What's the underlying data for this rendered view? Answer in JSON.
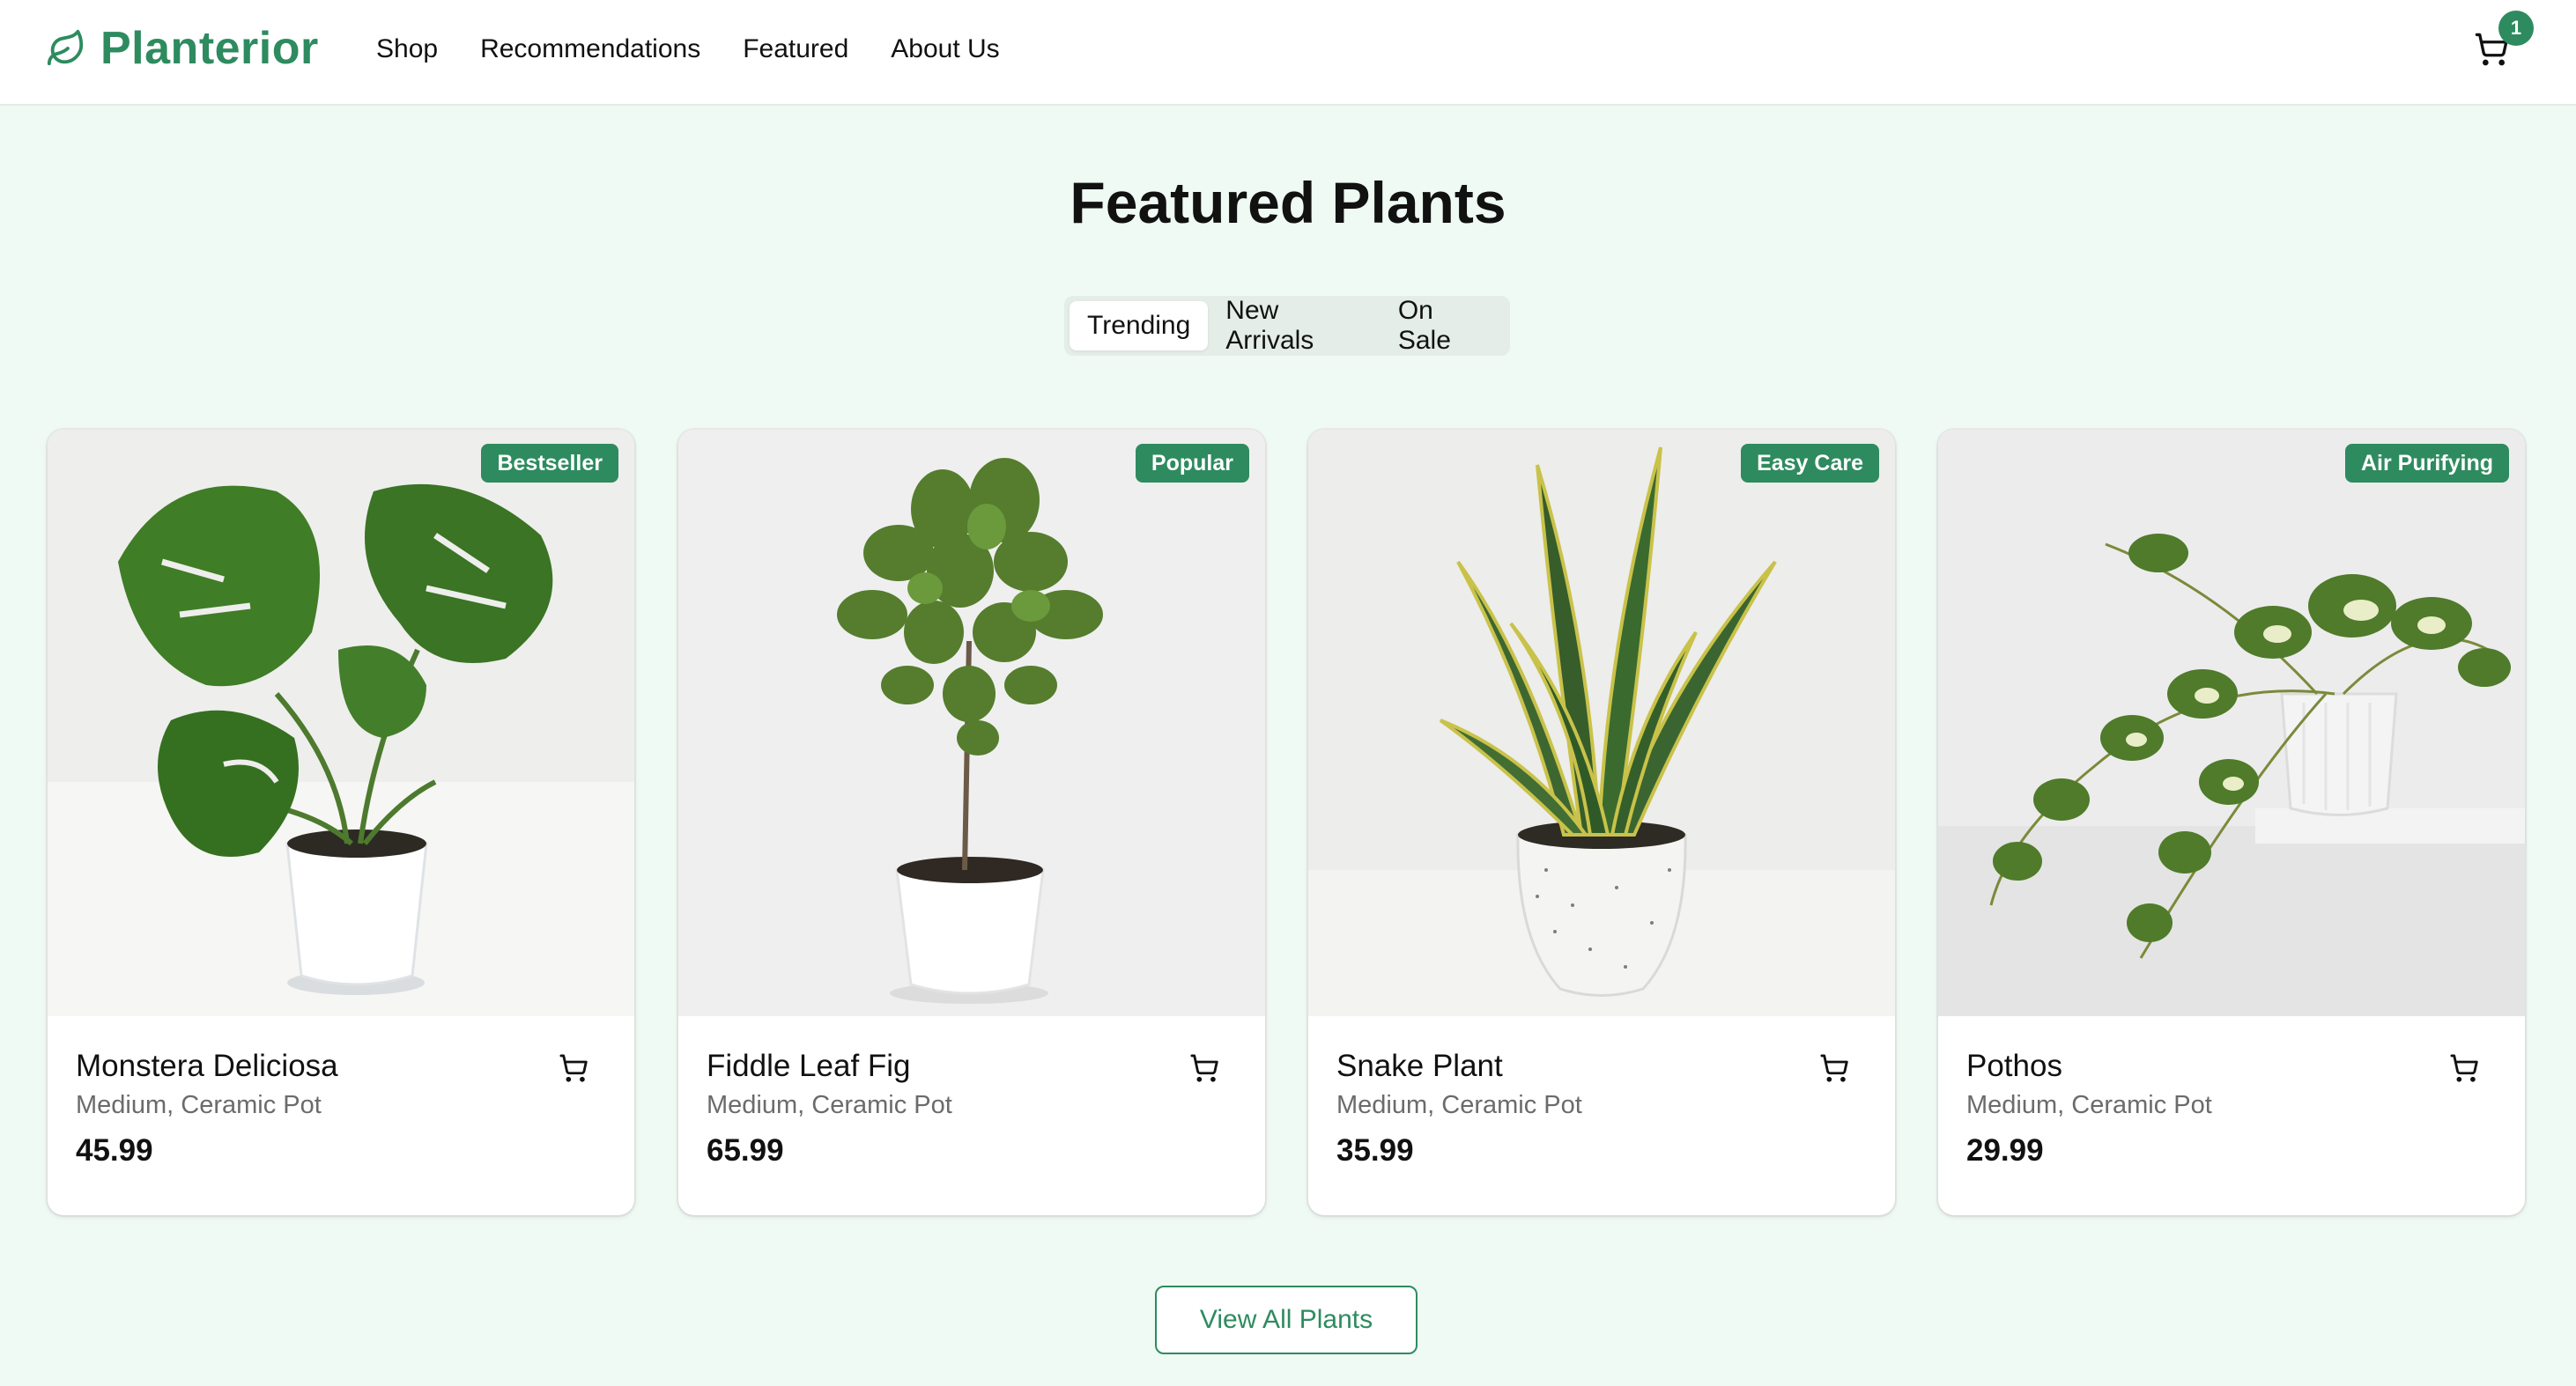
{
  "brand": {
    "name": "Planterior",
    "accent": "#2e8b5f"
  },
  "nav": {
    "items": [
      {
        "label": "Shop"
      },
      {
        "label": "Recommendations"
      },
      {
        "label": "Featured"
      },
      {
        "label": "About Us"
      }
    ]
  },
  "cart": {
    "count": "1",
    "icon": "cart-icon"
  },
  "main": {
    "title": "Featured Plants",
    "tabs": [
      {
        "label": "Trending",
        "active": true
      },
      {
        "label": "New Arrivals",
        "active": false
      },
      {
        "label": "On Sale",
        "active": false
      }
    ],
    "products": [
      {
        "name": "Monstera Deliciosa",
        "variant": "Medium, Ceramic Pot",
        "price": "45.99",
        "badge": "Bestseller"
      },
      {
        "name": "Fiddle Leaf Fig",
        "variant": "Medium, Ceramic Pot",
        "price": "65.99",
        "badge": "Popular"
      },
      {
        "name": "Snake Plant",
        "variant": "Medium, Ceramic Pot",
        "price": "35.99",
        "badge": "Easy Care"
      },
      {
        "name": "Pothos",
        "variant": "Medium, Ceramic Pot",
        "price": "29.99",
        "badge": "Air Purifying"
      }
    ],
    "view_all_label": "View All Plants"
  }
}
